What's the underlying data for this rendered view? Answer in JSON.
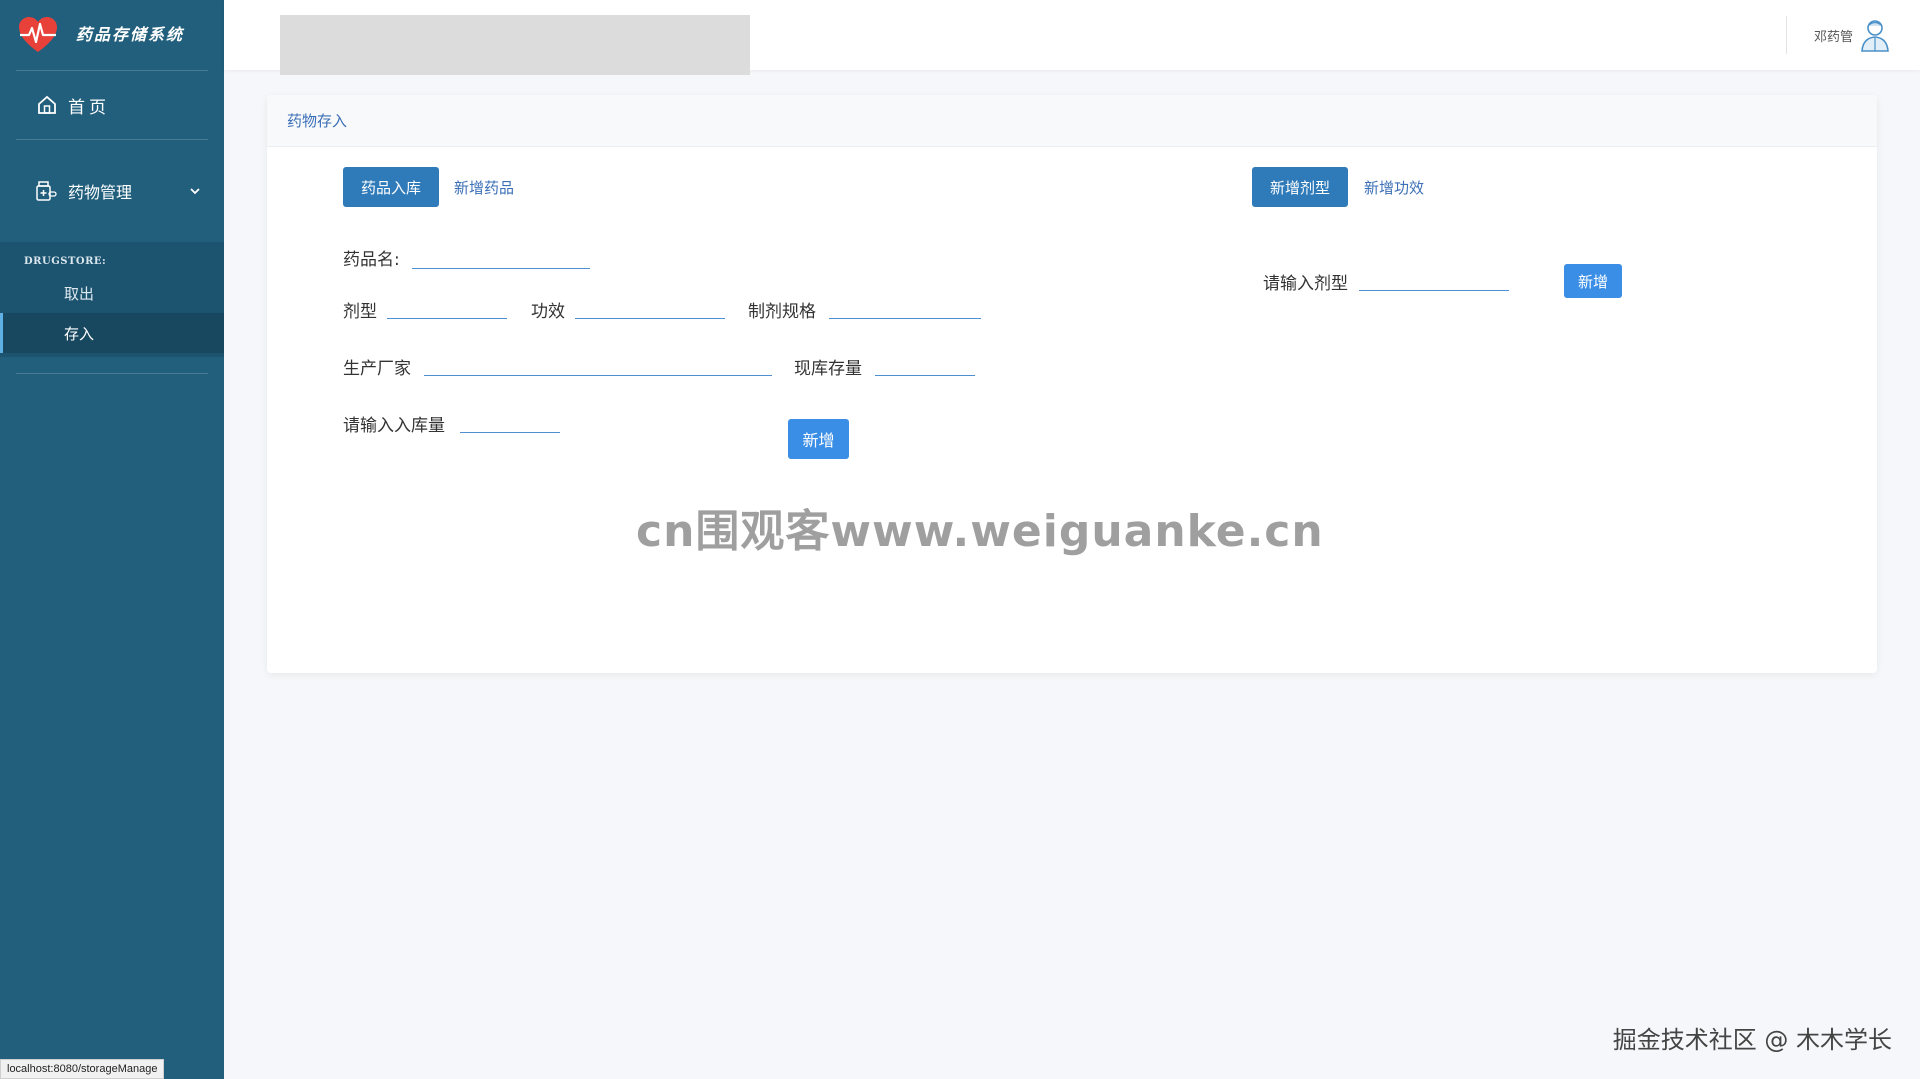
{
  "sidebar": {
    "brand_title": "药品存储系统",
    "home_label": "首页",
    "group_label": "药物管理",
    "submenu_heading": "DRUGSTORE:",
    "submenu_items": [
      {
        "label": "取出"
      },
      {
        "label": "存入",
        "active": true
      }
    ]
  },
  "header": {
    "user_name": "邓药管"
  },
  "card": {
    "title": "药物存入",
    "left_tabs": {
      "active_button": "药品入库",
      "link": "新增药品"
    },
    "right_tabs": {
      "active_button": "新增剂型",
      "link": "新增功效"
    },
    "form": {
      "drug_name_label": "药品名:",
      "dosage_form_label": "剂型",
      "efficacy_label": "功效",
      "spec_label": "制剂规格",
      "manufacturer_label": "生产厂家",
      "stock_label": "现库存量",
      "in_qty_label": "请输入入库量",
      "submit_label": "新增"
    },
    "dosage_form_form": {
      "input_label": "请输入剂型",
      "submit_label": "新增"
    }
  },
  "watermark": "cn围观客www.weiguanke.cn",
  "footer_credit": "掘金技术社区 @ 木木学长",
  "status_bar": "localhost:8080/storageManage",
  "colors": {
    "sidebar_bg": "#215f7d",
    "primary_button": "#2f7ab9",
    "accent_link": "#3b6fb6"
  },
  "icons": {
    "logo": "heart-pulse-icon",
    "home": "home-icon",
    "drug_mgmt": "medicine-icon",
    "chevron": "chevron-down-icon",
    "avatar": "doctor-avatar-icon"
  }
}
